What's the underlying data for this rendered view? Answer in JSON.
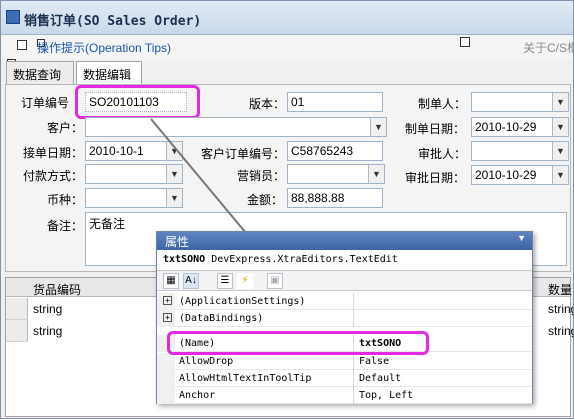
{
  "window": {
    "title": "销售订单(SO Sales Order)"
  },
  "toolbar": {
    "tips_label": "操作提示(Operation Tips)",
    "about_label": "关于C/S框"
  },
  "tabs": [
    {
      "label": "数据查询"
    },
    {
      "label": "数据编辑"
    }
  ],
  "form": {
    "order_no": {
      "label": "订单编号",
      "value": "SO20101103"
    },
    "version": {
      "label": "版本：",
      "value": "01"
    },
    "maker": {
      "label": "制单人：",
      "value": ""
    },
    "customer": {
      "label": "客户：",
      "value": ""
    },
    "make_date": {
      "label": "制单日期：",
      "value": "2010-10-29"
    },
    "order_date": {
      "label": "接单日期：",
      "value": "2010-10-1"
    },
    "customer_order_no": {
      "label": "客户订单编号：",
      "value": "C58765243"
    },
    "approver": {
      "label": "审批人：",
      "value": ""
    },
    "payment": {
      "label": "付款方式：",
      "value": ""
    },
    "salesman": {
      "label": "营销员：",
      "value": ""
    },
    "approve_date": {
      "label": "审批日期：",
      "value": "2010-10-29"
    },
    "currency": {
      "label": "币种：",
      "value": ""
    },
    "amount": {
      "label": "金额：",
      "value": "88,888.88"
    },
    "remark": {
      "label": "备注：",
      "value": "无备注"
    }
  },
  "grid": {
    "columns": [
      "货品编码",
      "数量"
    ],
    "rows": [
      [
        "string",
        "string"
      ],
      [
        "string",
        "string"
      ]
    ]
  },
  "properties": {
    "title": "属性",
    "object_name": "txtSONO",
    "object_type": "DevExpress.XtraEditors.TextEdit",
    "rows": [
      {
        "key": "(ApplicationSettings)",
        "value": "",
        "expandable": true
      },
      {
        "key": "(DataBindings)",
        "value": "",
        "expandable": true
      },
      {
        "key": "(Name)",
        "value": "txtSONO",
        "expandable": false
      },
      {
        "key": "AllowDrop",
        "value": "False",
        "expandable": false
      },
      {
        "key": "AllowHtmlTextInToolTip",
        "value": "Default",
        "expandable": false
      },
      {
        "key": "Anchor",
        "value": "Top, Left",
        "expandable": false
      }
    ]
  },
  "colors": {
    "highlight": "#e22be0",
    "title_bg": "#c9d8ea",
    "prop_header": "#3c63a5",
    "link": "#1a55b5"
  },
  "icons": [
    "window-icon",
    "save-icon",
    "tips-icon",
    "about-icon",
    "dropdown-arrow-icon",
    "categorized-icon",
    "alphabetical-icon",
    "properties-icon",
    "events-icon",
    "property-pages-icon"
  ]
}
